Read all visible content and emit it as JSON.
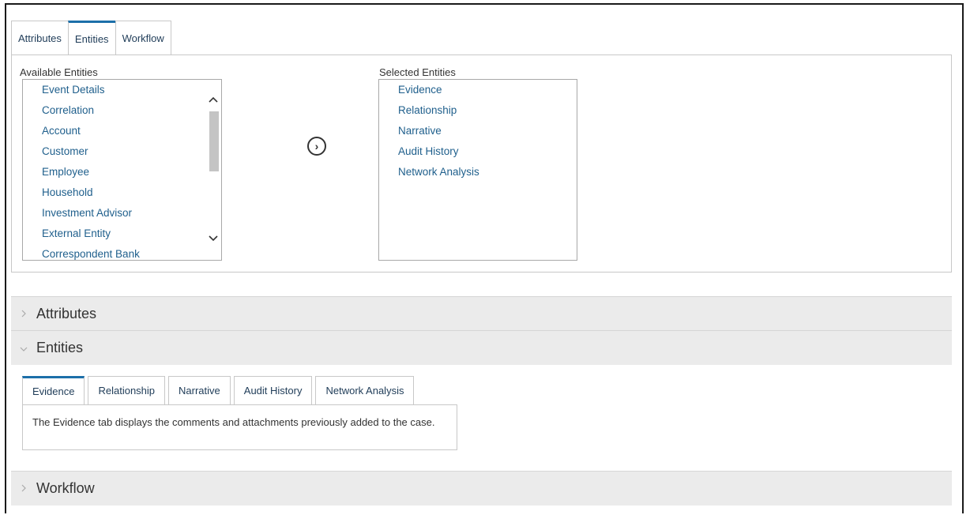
{
  "top_tabs": [
    {
      "label": "Attributes",
      "active": false
    },
    {
      "label": "Entities",
      "active": true
    },
    {
      "label": "Workflow",
      "active": false
    }
  ],
  "available": {
    "label": "Available Entities",
    "items": [
      "Event Details",
      "Correlation",
      "Account",
      "Customer",
      "Employee",
      "Household",
      "Investment Advisor",
      "External Entity",
      "Correspondent Bank"
    ]
  },
  "selected": {
    "label": "Selected Entities",
    "items": [
      "Evidence",
      "Relationship",
      "Narrative",
      "Audit History",
      "Network Analysis"
    ]
  },
  "move_button": {
    "symbol": "›",
    "icon": "chevron-right-circle-icon"
  },
  "accordion": {
    "attributes": {
      "title": "Attributes",
      "expanded": false
    },
    "entities": {
      "title": "Entities",
      "expanded": true
    },
    "workflow": {
      "title": "Workflow",
      "expanded": false
    }
  },
  "entity_tabs": [
    {
      "label": "Evidence",
      "active": true
    },
    {
      "label": "Relationship",
      "active": false
    },
    {
      "label": "Narrative",
      "active": false
    },
    {
      "label": "Audit History",
      "active": false
    },
    {
      "label": "Network Analysis",
      "active": false
    }
  ],
  "evidence_text": "The Evidence tab displays the comments and attachments previously added to the case.",
  "colors": {
    "accent": "#1c6fa9",
    "link": "#1f5f8c",
    "header_bg": "#ebebeb"
  }
}
